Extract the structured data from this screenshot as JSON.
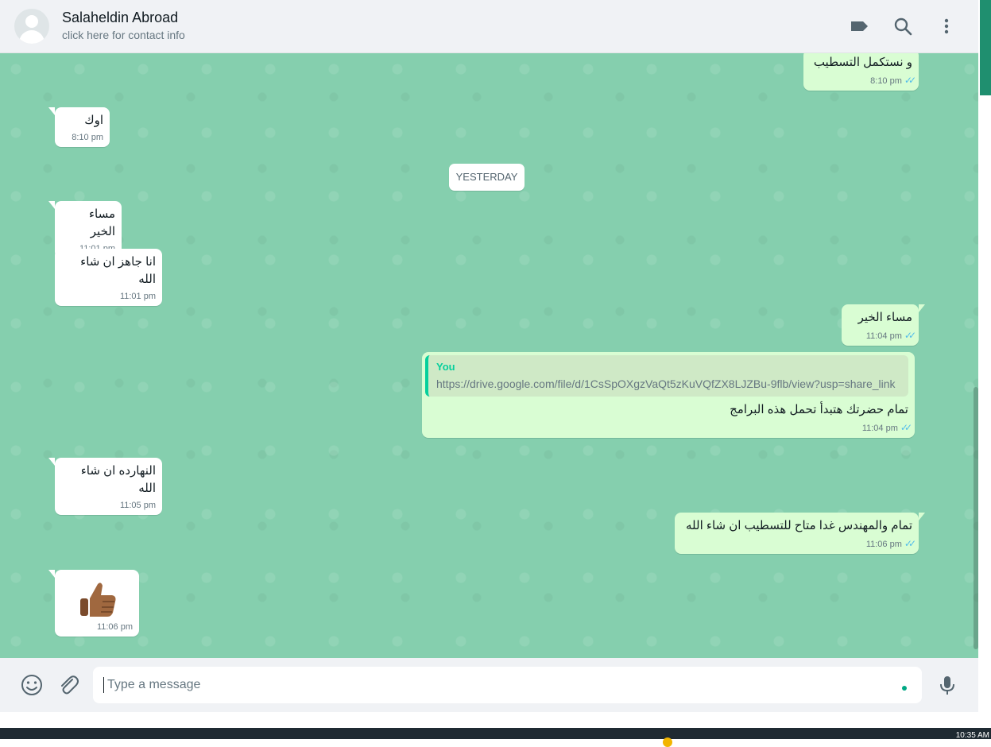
{
  "header": {
    "contact_name": "Salaheldin Abroad",
    "contact_sub": "click here for contact info",
    "icons": [
      "label-icon",
      "search-icon",
      "menu-icon"
    ]
  },
  "chat": {
    "date_divider": "YESTERDAY",
    "messages": [
      {
        "dir": "out",
        "text": "و نستكمل التسطيب",
        "time": "8:10 pm"
      },
      {
        "dir": "in",
        "text": "اوك",
        "time": "8:10 pm"
      },
      {
        "dir": "in",
        "text": "مساء الخير",
        "time": "11:01 pm"
      },
      {
        "dir": "in",
        "text": "انا جاهز ان شاء الله",
        "time": "11:01 pm"
      },
      {
        "dir": "out",
        "text": "مساء الخير",
        "time": "11:04 pm"
      },
      {
        "dir": "out",
        "quote_author": "You",
        "quote_text": "https://drive.google.com/file/d/1CsSpOXgzVaQt5zKuVQfZX8LJZBu-9flb/view?usp=share_link",
        "text": "تمام حضرتك هتبدأ تحمل هذه البرامج",
        "time": "11:04 pm"
      },
      {
        "dir": "in",
        "text": "النهارده ان شاء الله",
        "time": "11:05 pm"
      },
      {
        "dir": "out",
        "text": "تمام والمهندس غدا متاح للتسطيب ان شاء الله",
        "time": "11:06 pm"
      },
      {
        "dir": "in",
        "emoji": "thumbs-up",
        "time": "11:06 pm"
      }
    ]
  },
  "footer": {
    "placeholder": "Type a message",
    "icons": [
      "emoji-icon",
      "attach-icon",
      "mic-icon"
    ]
  },
  "taskbar": {
    "clock": "10:35 AM"
  },
  "colors": {
    "chat_bg": "#85cfae",
    "outgoing": "#d9fdd3",
    "incoming": "#ffffff",
    "read_ticks": "#53bdeb",
    "quote_accent": "#06cf9c"
  }
}
